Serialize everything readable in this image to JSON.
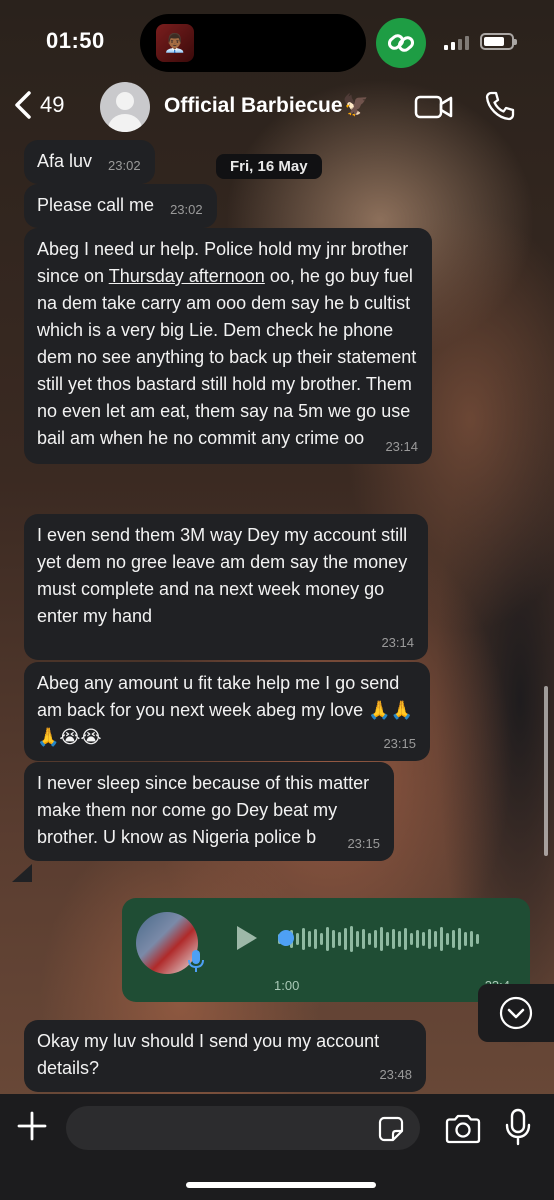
{
  "status_bar": {
    "time": "01:50",
    "island_emoji": "👨🏾‍💼"
  },
  "header": {
    "back_count": "49",
    "contact_name": "Official Barbiecue🦅"
  },
  "date_divider": "Fri, 16 May",
  "messages": [
    {
      "text": "Afa luv",
      "time": "23:02"
    },
    {
      "text": "Please call me",
      "time": "23:02"
    },
    {
      "text_before": "Abeg I need ur help. Police hold my jnr brother since on ",
      "link": "Thursday afternoon",
      "text_after": " oo, he go buy fuel na dem take carry am ooo dem say he b cultist which is a very big Lie. Dem  check he phone dem no see anything to back up their statement still yet thos bastard still hold my brother. Them no even let am eat, them say na 5m we go use bail am when he no commit any crime oo",
      "time": "23:14"
    },
    {
      "text": "I even send them 3M way Dey my account still yet dem no gree leave am dem say the money must complete and na next week money go enter my hand",
      "time": "23:14"
    },
    {
      "text": "Abeg any amount u fit take help me I go send am back for you next week abeg my love 🙏🙏🙏😭😭",
      "time": "23:15"
    },
    {
      "text": "I never sleep since because of this matter make them nor come go Dey beat my brother. U know as Nigeria police b",
      "time": "23:15"
    },
    {
      "text": "Okay my luv should I send you my account details?",
      "time": "23:48"
    }
  ],
  "voice_note": {
    "duration": "1:00",
    "time": "23:4",
    "progress": 0
  },
  "composer": {
    "placeholder": ""
  },
  "colors": {
    "incoming_bubble": "#202124",
    "outgoing_bubble": "#1f4d34",
    "call_indicator": "#1e9d44",
    "voice_progress": "#4ea0f5"
  },
  "icons": [
    "back-chevron-icon",
    "video-call-icon",
    "phone-icon",
    "link-icon",
    "play-icon",
    "mic-icon",
    "plus-icon",
    "sticker-icon",
    "camera-icon",
    "chevron-down-icon"
  ]
}
